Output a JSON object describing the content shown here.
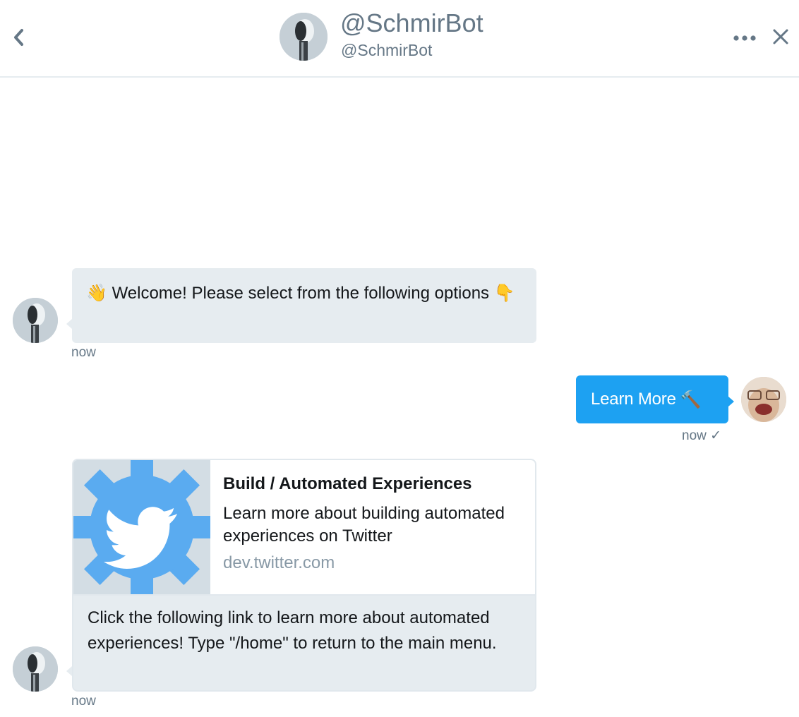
{
  "colors": {
    "accent": "#1da1f2",
    "bubble_incoming": "#e6ecf0",
    "secondary_text": "#657786",
    "link_domain": "#8899a6",
    "card_brand_blue": "#5aabf0"
  },
  "header": {
    "name": "@SchmirBot",
    "handle": "@SchmirBot",
    "back_icon": "chevron-left-icon",
    "more_icon": "more-horizontal-icon",
    "close_icon": "close-icon"
  },
  "messages": {
    "welcome": {
      "emoji_wave": "👋",
      "text": "Welcome! Please select from the following options",
      "emoji_point": "👇",
      "timestamp": "now"
    },
    "user_reply": {
      "text": "Learn More",
      "emoji": "🔨",
      "timestamp": "now",
      "status_icon": "✓"
    },
    "card_message": {
      "card": {
        "title": "Build / Automated Experiences",
        "description": "Learn more about building automated experiences on Twitter",
        "domain": "dev.twitter.com",
        "image_icon": "twitter-gear-logo-icon"
      },
      "text": "Click the following link to learn more about automated experiences! Type \"/home\" to return to the main menu.",
      "timestamp": "now"
    }
  }
}
